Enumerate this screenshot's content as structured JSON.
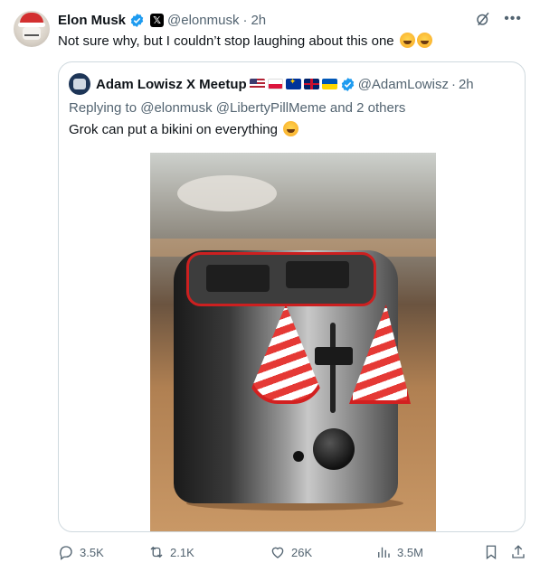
{
  "author": {
    "name": "Elon Musk",
    "handle": "@elonmusk",
    "separator": "·",
    "time": "2h",
    "badge_icon": "verified-badge-icon",
    "affiliation_icon": "x-logo-icon"
  },
  "tweet": {
    "text": "Not sure why, but I couldn’t stop laughing about this one",
    "emojis": [
      "rolling-on-floor-laughing",
      "rolling-on-floor-laughing"
    ]
  },
  "quote": {
    "name": "Adam Lowisz X Meetup",
    "flags": [
      "us",
      "pl",
      "eu",
      "uk",
      "ua"
    ],
    "handle": "@AdamLowisz",
    "separator": "·",
    "time": "2h",
    "reply_prefix": "Replying to",
    "reply_mentions": "@elonmusk @LibertyPillMeme",
    "reply_suffix": "and 2 others",
    "text": "Grok can put a bikini on everything",
    "emoji": "rolling-on-floor-laughing",
    "image_alt": "toaster wearing a red and white striped bikini top"
  },
  "actions": {
    "replies": "3.5K",
    "reposts": "2.1K",
    "likes": "26K",
    "views": "3.5M"
  },
  "colors": {
    "text": "#0f1419",
    "secondary": "#536471",
    "border": "#cfd9de",
    "verified": "#1d9bf0"
  }
}
